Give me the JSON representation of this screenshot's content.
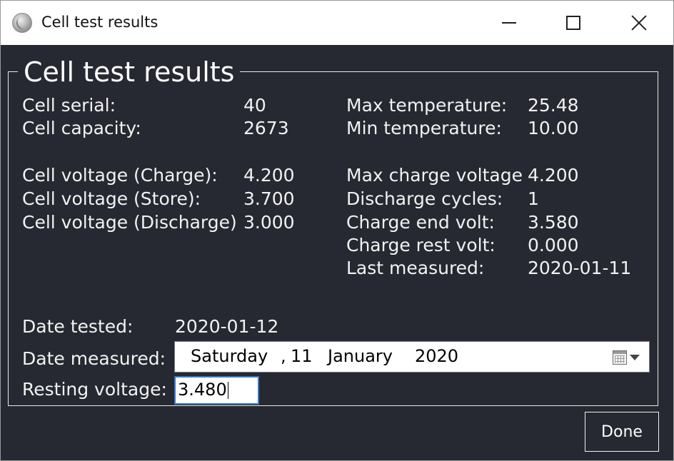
{
  "window": {
    "title": "Cell test results",
    "controls": {
      "minimize": "minimize",
      "maximize": "maximize",
      "close": "close"
    }
  },
  "group": {
    "title": "Cell test results"
  },
  "left_details": [
    {
      "label": "Cell serial:",
      "value": "40"
    },
    {
      "label": "Cell capacity:",
      "value": "2673"
    },
    {
      "label": "Cell voltage (Charge):",
      "value": "4.200"
    },
    {
      "label": "Cell voltage (Store):",
      "value": "3.700"
    },
    {
      "label": "Cell voltage (Discharge)",
      "value": "3.000"
    }
  ],
  "right_details": [
    {
      "label": "Max temperature:",
      "value": "25.48"
    },
    {
      "label": "Min temperature:",
      "value": "10.00"
    },
    {
      "label": "Max charge voltage",
      "value": "4.200"
    },
    {
      "label": "Discharge cycles:",
      "value": "1"
    },
    {
      "label": "Charge end volt:",
      "value": "3.580"
    },
    {
      "label": "Charge rest volt:",
      "value": "0.000"
    },
    {
      "label": "Last measured:",
      "value": "2020-01-11"
    }
  ],
  "date_tested": {
    "label": "Date tested:",
    "value": "2020-01-12"
  },
  "date_measured": {
    "label": "Date measured:",
    "day": "Saturday",
    "separator": ",",
    "date": "11",
    "month": "January",
    "year": "2020",
    "icon": "calendar-icon"
  },
  "resting_voltage": {
    "label": "Resting voltage:",
    "value": "3.480"
  },
  "buttons": {
    "done": "Done"
  },
  "colors": {
    "background": "#262931",
    "text": "#f2f2f2",
    "input_focus": "#3b78c4",
    "underlay_red": "#8a2f22",
    "underlay_green": "#23a33a"
  }
}
